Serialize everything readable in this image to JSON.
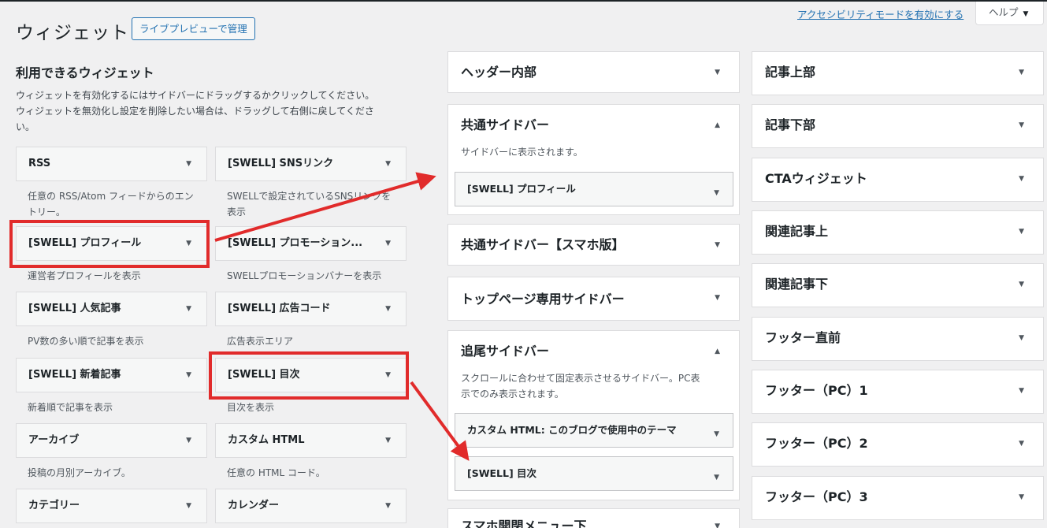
{
  "header": {
    "title": "ウィジェット",
    "live_preview_label": "ライブプレビューで管理",
    "accessibility_link": "アクセシビリティモードを有効にする",
    "help_label": "ヘルプ"
  },
  "available": {
    "title": "利用できるウィジェット",
    "desc_line1": "ウィジェットを有効化するにはサイドバーにドラッグするかクリックしてください。",
    "desc_line2": "ウィジェットを無効化し設定を削除したい場合は、ドラッグして右側に戻してくださ",
    "desc_line3": "い。",
    "widgets": [
      {
        "name": "RSS",
        "desc": "任意の RSS/Atom フィードからのエントリー。"
      },
      {
        "name": "[SWELL] SNSリンク",
        "desc": "SWELLで設定されているSNSリンクを表示"
      },
      {
        "name": "[SWELL] プロフィール",
        "desc": "運営者プロフィールを表示"
      },
      {
        "name": "[SWELL] プロモーション...",
        "desc": "SWELLプロモーションバナーを表示"
      },
      {
        "name": "[SWELL] 人気記事",
        "desc": "PV数の多い順で記事を表示"
      },
      {
        "name": "[SWELL] 広告コード",
        "desc": "広告表示エリア"
      },
      {
        "name": "[SWELL] 新着記事",
        "desc": "新着順で記事を表示"
      },
      {
        "name": "[SWELL] 目次",
        "desc": "目次を表示"
      },
      {
        "name": "アーカイブ",
        "desc": "投稿の月別アーカイブ。"
      },
      {
        "name": "カスタム HTML",
        "desc": "任意の HTML コード。"
      },
      {
        "name": "カテゴリー",
        "desc": ""
      },
      {
        "name": "カレンダー",
        "desc": ""
      }
    ]
  },
  "areas_middle": [
    {
      "title": "ヘッダー内部"
    },
    {
      "title": "共通サイドバー",
      "desc": "サイドバーに表示されます。",
      "widgets": [
        "[SWELL] プロフィール"
      ]
    },
    {
      "title": "共通サイドバー【スマホ版】"
    },
    {
      "title": "トップページ専用サイドバー"
    },
    {
      "title": "追尾サイドバー",
      "desc_line1": "スクロールに合わせて固定表示させるサイドバー。PC表",
      "desc_line2": "示でのみ表示されます。",
      "widgets": [
        "カスタム HTML: このブログで使用中のテーマ",
        "[SWELL] 目次"
      ]
    },
    {
      "title": "スマホ開閉メニュー下"
    }
  ],
  "areas_right": [
    {
      "title": "記事上部"
    },
    {
      "title": "記事下部"
    },
    {
      "title": "CTAウィジェット"
    },
    {
      "title": "関連記事上"
    },
    {
      "title": "関連記事下"
    },
    {
      "title": "フッター直前"
    },
    {
      "title": "フッター（PC）1"
    },
    {
      "title": "フッター（PC）2"
    },
    {
      "title": "フッター（PC）3"
    }
  ],
  "icons": {
    "collapse": "triangle-down-icon",
    "expand": "triangle-up-icon"
  },
  "colors": {
    "highlight": "#e12b2b",
    "link": "#2271b1"
  }
}
